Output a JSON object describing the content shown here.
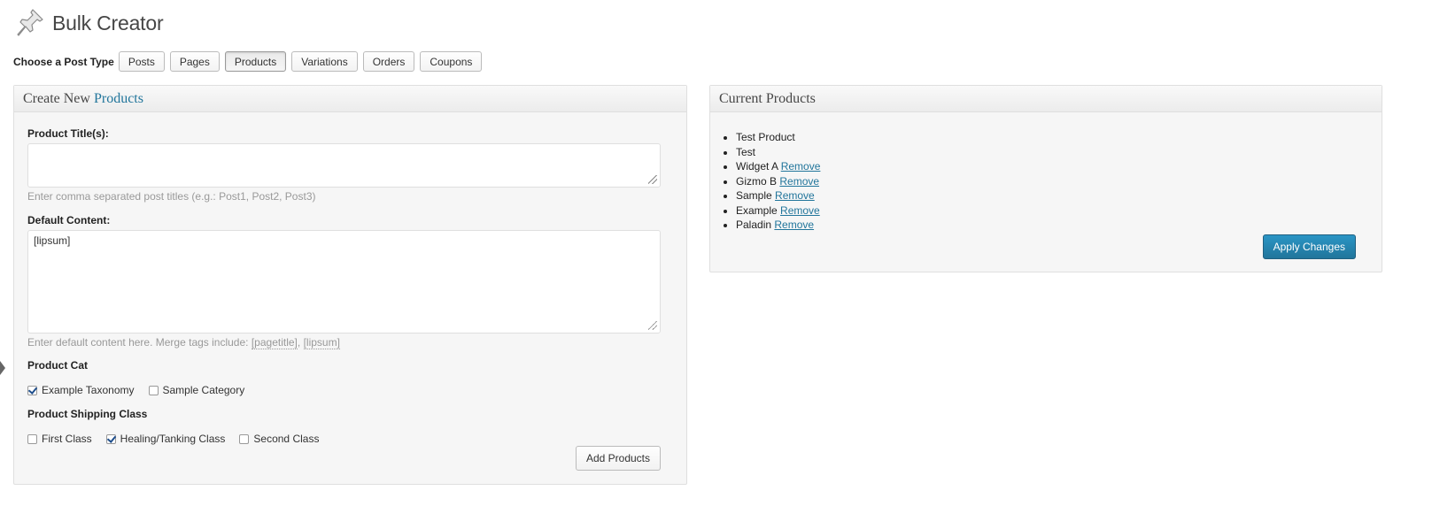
{
  "page": {
    "title": "Bulk Creator"
  },
  "post_type": {
    "label": "Choose a Post Type",
    "buttons": [
      "Posts",
      "Pages",
      "Products",
      "Variations",
      "Orders",
      "Coupons"
    ],
    "active": "Products"
  },
  "create_panel": {
    "heading_prefix": "Create New",
    "heading_type": "Products",
    "titles_label": "Product Title(s):",
    "titles_value": "",
    "titles_hint": "Enter comma separated post titles (e.g.: Post1, Post2, Post3)",
    "content_label": "Default Content:",
    "content_value": "[lipsum]",
    "content_hint_prefix": "Enter default content here. Merge tags include:",
    "merge_tags": [
      "[pagetitle]",
      "[lipsum]"
    ],
    "product_cat_label": "Product Cat",
    "product_cat": [
      {
        "label": "Example Taxonomy",
        "checked": true
      },
      {
        "label": "Sample Category",
        "checked": false
      }
    ],
    "shipping_label": "Product Shipping Class",
    "shipping": [
      {
        "label": "First Class",
        "checked": false
      },
      {
        "label": "Healing/Tanking Class",
        "checked": true
      },
      {
        "label": "Second Class",
        "checked": false
      }
    ],
    "add_button": "Add Products"
  },
  "current_panel": {
    "heading": "Current Products",
    "items": [
      {
        "name": "Test Product",
        "remove": ""
      },
      {
        "name": "Test",
        "remove": ""
      },
      {
        "name": "Widget A",
        "remove": "Remove"
      },
      {
        "name": "Gizmo B",
        "remove": "Remove"
      },
      {
        "name": "Sample",
        "remove": "Remove"
      },
      {
        "name": "Example",
        "remove": "Remove"
      },
      {
        "name": "Paladin",
        "remove": "Remove"
      }
    ],
    "apply_button": "Apply Changes"
  },
  "colors": {
    "accent": "#21759b",
    "primary_button": "#2a95c5"
  }
}
